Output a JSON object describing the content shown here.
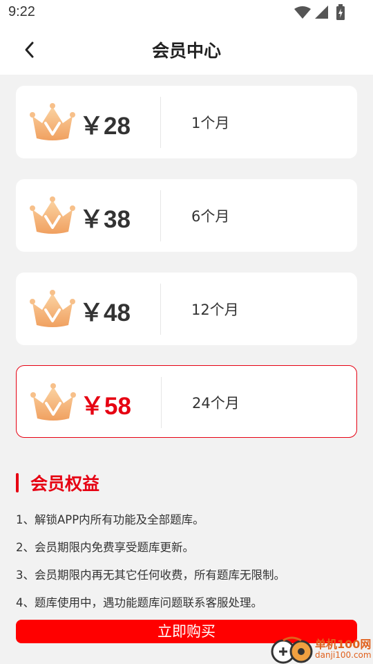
{
  "status_bar": {
    "time": "9:22"
  },
  "header": {
    "title": "会员中心"
  },
  "plans": [
    {
      "price": "￥28",
      "duration": "1个月",
      "selected": false
    },
    {
      "price": "￥38",
      "duration": "6个月",
      "selected": false
    },
    {
      "price": "￥48",
      "duration": "12个月",
      "selected": false
    },
    {
      "price": "￥58",
      "duration": "24个月",
      "selected": true
    }
  ],
  "benefits": {
    "title": "会员权益",
    "items": [
      "1、解锁APP内所有功能及全部题库。",
      "2、会员期限内免费享受题库更新。",
      "3、会员期限内再无其它任何收费，所有题库无限制。",
      "4、题库使用中，遇功能题库问题联系客服处理。"
    ]
  },
  "buy_button": {
    "label": "立即购买"
  },
  "watermark": {
    "text": "单机100网",
    "sub": "danji100.com"
  },
  "colors": {
    "accent": "#e60012",
    "button": "#ff0000",
    "crown": "#f5b06a"
  }
}
